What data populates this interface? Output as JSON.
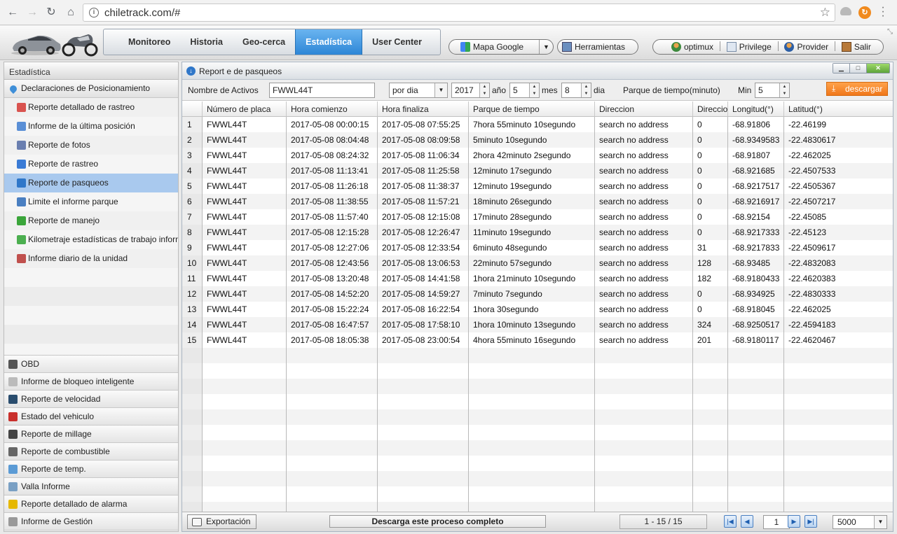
{
  "browser": {
    "url": "chiletrack.com/#",
    "back": "←",
    "forward": "→",
    "reload": "↻",
    "home": "⌂"
  },
  "header": {
    "tabs": [
      {
        "label": "Monitoreo"
      },
      {
        "label": "Historia"
      },
      {
        "label": "Geo-cerca"
      },
      {
        "label": "Estadística",
        "active": true
      },
      {
        "label": "User Center"
      }
    ],
    "map_label": "Mapa Google",
    "tools_label": "Herramientas",
    "user_label": "optimux",
    "privilege_label": "Privilege",
    "provider_label": "Provider",
    "logout_label": "Salir"
  },
  "sidebar": {
    "title": "Estadística",
    "group_label": "Declaraciones de Posicionamiento",
    "items": [
      {
        "label": "Reporte detallado de rastreo",
        "icon": "report-icon",
        "color": "#d9534f"
      },
      {
        "label": "Informe de la última posición",
        "icon": "position-icon",
        "color": "#5a8fd6"
      },
      {
        "label": "Reporte de fotos",
        "icon": "photo-icon",
        "color": "#6a7fb0"
      },
      {
        "label": "Reporte de rastreo",
        "icon": "globe-icon",
        "color": "#3a7bd5"
      },
      {
        "label": "Reporte de pasqueos",
        "icon": "parking-icon",
        "color": "#2f77c9",
        "active": true
      },
      {
        "label": "Limite el informe parque",
        "icon": "limit-icon",
        "color": "#4a7fc1"
      },
      {
        "label": "Reporte de manejo",
        "icon": "drive-icon",
        "color": "#3aa53a"
      },
      {
        "label": "Kilometraje estadísticas de trabajo informe",
        "icon": "mileage-icon",
        "color": "#4caf50"
      },
      {
        "label": "Informe diario de la unidad",
        "icon": "calendar-icon",
        "color": "#c0504d"
      }
    ],
    "categories": [
      {
        "label": "OBD",
        "icon": "obd-icon",
        "color": "#555555"
      },
      {
        "label": "Informe de bloqueo inteligente",
        "icon": "lock-report-icon",
        "color": "#bbbbbb"
      },
      {
        "label": "Reporte de velocidad",
        "icon": "speed-icon",
        "color": "#2a4d6e"
      },
      {
        "label": "Estado del vehiculo",
        "icon": "car-status-icon",
        "color": "#c9302c"
      },
      {
        "label": "Reporte de millage",
        "icon": "millage-icon",
        "color": "#444444"
      },
      {
        "label": "Reporte de combustible",
        "icon": "fuel-icon",
        "color": "#666666"
      },
      {
        "label": "Reporte de temp.",
        "icon": "temp-icon",
        "color": "#5b9bd5"
      },
      {
        "label": "Valla Informe",
        "icon": "fence-icon",
        "color": "#7aa0c4"
      },
      {
        "label": "Reporte detallado de alarma",
        "icon": "alarm-icon",
        "color": "#e6b800"
      },
      {
        "label": "Informe de Gestión",
        "icon": "management-icon",
        "color": "#999999"
      }
    ]
  },
  "panel": {
    "title": "Report e de pasqueos",
    "filter": {
      "asset_label": "Nombre de Activos",
      "asset_value": "FWWL44T",
      "period_value": "por dia",
      "year_value": "2017",
      "year_label": "año",
      "month_value": "5",
      "month_label": "mes",
      "day_value": "8",
      "day_label": "dia",
      "park_label": "Parque de tiempo(minuto)",
      "min_label": "Min",
      "min_value": "5",
      "download_label": "descargar"
    },
    "columns": [
      "",
      "Número de placa",
      "Hora comienzo",
      "Hora  finaliza",
      "Parque de tiempo",
      "Direccion",
      "Direccio",
      "Longitud(°)",
      "Latitud(°)"
    ],
    "rows": [
      [
        "1",
        "FWWL44T",
        "2017-05-08 00:00:15",
        "2017-05-08 07:55:25",
        "7hora 55minuto 10segundo",
        "search no address",
        "0",
        "-68.91806",
        "-22.46199"
      ],
      [
        "2",
        "FWWL44T",
        "2017-05-08 08:04:48",
        "2017-05-08 08:09:58",
        "5minuto 10segundo",
        "search no address",
        "0",
        "-68.9349583",
        "-22.4830617"
      ],
      [
        "3",
        "FWWL44T",
        "2017-05-08 08:24:32",
        "2017-05-08 11:06:34",
        "2hora 42minuto 2segundo",
        "search no address",
        "0",
        "-68.91807",
        "-22.462025"
      ],
      [
        "4",
        "FWWL44T",
        "2017-05-08 11:13:41",
        "2017-05-08 11:25:58",
        "12minuto 17segundo",
        "search no address",
        "0",
        "-68.921685",
        "-22.4507533"
      ],
      [
        "5",
        "FWWL44T",
        "2017-05-08 11:26:18",
        "2017-05-08 11:38:37",
        "12minuto 19segundo",
        "search no address",
        "0",
        "-68.9217517",
        "-22.4505367"
      ],
      [
        "6",
        "FWWL44T",
        "2017-05-08 11:38:55",
        "2017-05-08 11:57:21",
        "18minuto 26segundo",
        "search no address",
        "0",
        "-68.9216917",
        "-22.4507217"
      ],
      [
        "7",
        "FWWL44T",
        "2017-05-08 11:57:40",
        "2017-05-08 12:15:08",
        "17minuto 28segundo",
        "search no address",
        "0",
        "-68.92154",
        "-22.45085"
      ],
      [
        "8",
        "FWWL44T",
        "2017-05-08 12:15:28",
        "2017-05-08 12:26:47",
        "11minuto 19segundo",
        "search no address",
        "0",
        "-68.9217333",
        "-22.45123"
      ],
      [
        "9",
        "FWWL44T",
        "2017-05-08 12:27:06",
        "2017-05-08 12:33:54",
        "6minuto 48segundo",
        "search no address",
        "31",
        "-68.9217833",
        "-22.4509617"
      ],
      [
        "10",
        "FWWL44T",
        "2017-05-08 12:43:56",
        "2017-05-08 13:06:53",
        "22minuto 57segundo",
        "search no address",
        "128",
        "-68.93485",
        "-22.4832083"
      ],
      [
        "11",
        "FWWL44T",
        "2017-05-08 13:20:48",
        "2017-05-08 14:41:58",
        "1hora 21minuto 10segundo",
        "search no address",
        "182",
        "-68.9180433",
        "-22.4620383"
      ],
      [
        "12",
        "FWWL44T",
        "2017-05-08 14:52:20",
        "2017-05-08 14:59:27",
        "7minuto 7segundo",
        "search no address",
        "0",
        "-68.934925",
        "-22.4830333"
      ],
      [
        "13",
        "FWWL44T",
        "2017-05-08 15:22:24",
        "2017-05-08 16:22:54",
        "1hora 30segundo",
        "search no address",
        "0",
        "-68.918045",
        "-22.462025"
      ],
      [
        "14",
        "FWWL44T",
        "2017-05-08 16:47:57",
        "2017-05-08 17:58:10",
        "1hora 10minuto 13segundo",
        "search no address",
        "324",
        "-68.9250517",
        "-22.4594183"
      ],
      [
        "15",
        "FWWL44T",
        "2017-05-08 18:05:38",
        "2017-05-08 23:00:54",
        "4hora 55minuto 16segundo",
        "search no address",
        "201",
        "-68.9180117",
        "-22.4620467"
      ]
    ],
    "footer": {
      "export_label": "Exportación",
      "status": "Descarga este proceso completo",
      "range": "1 - 15 / 15",
      "page": "1",
      "per_page": "5000"
    }
  }
}
